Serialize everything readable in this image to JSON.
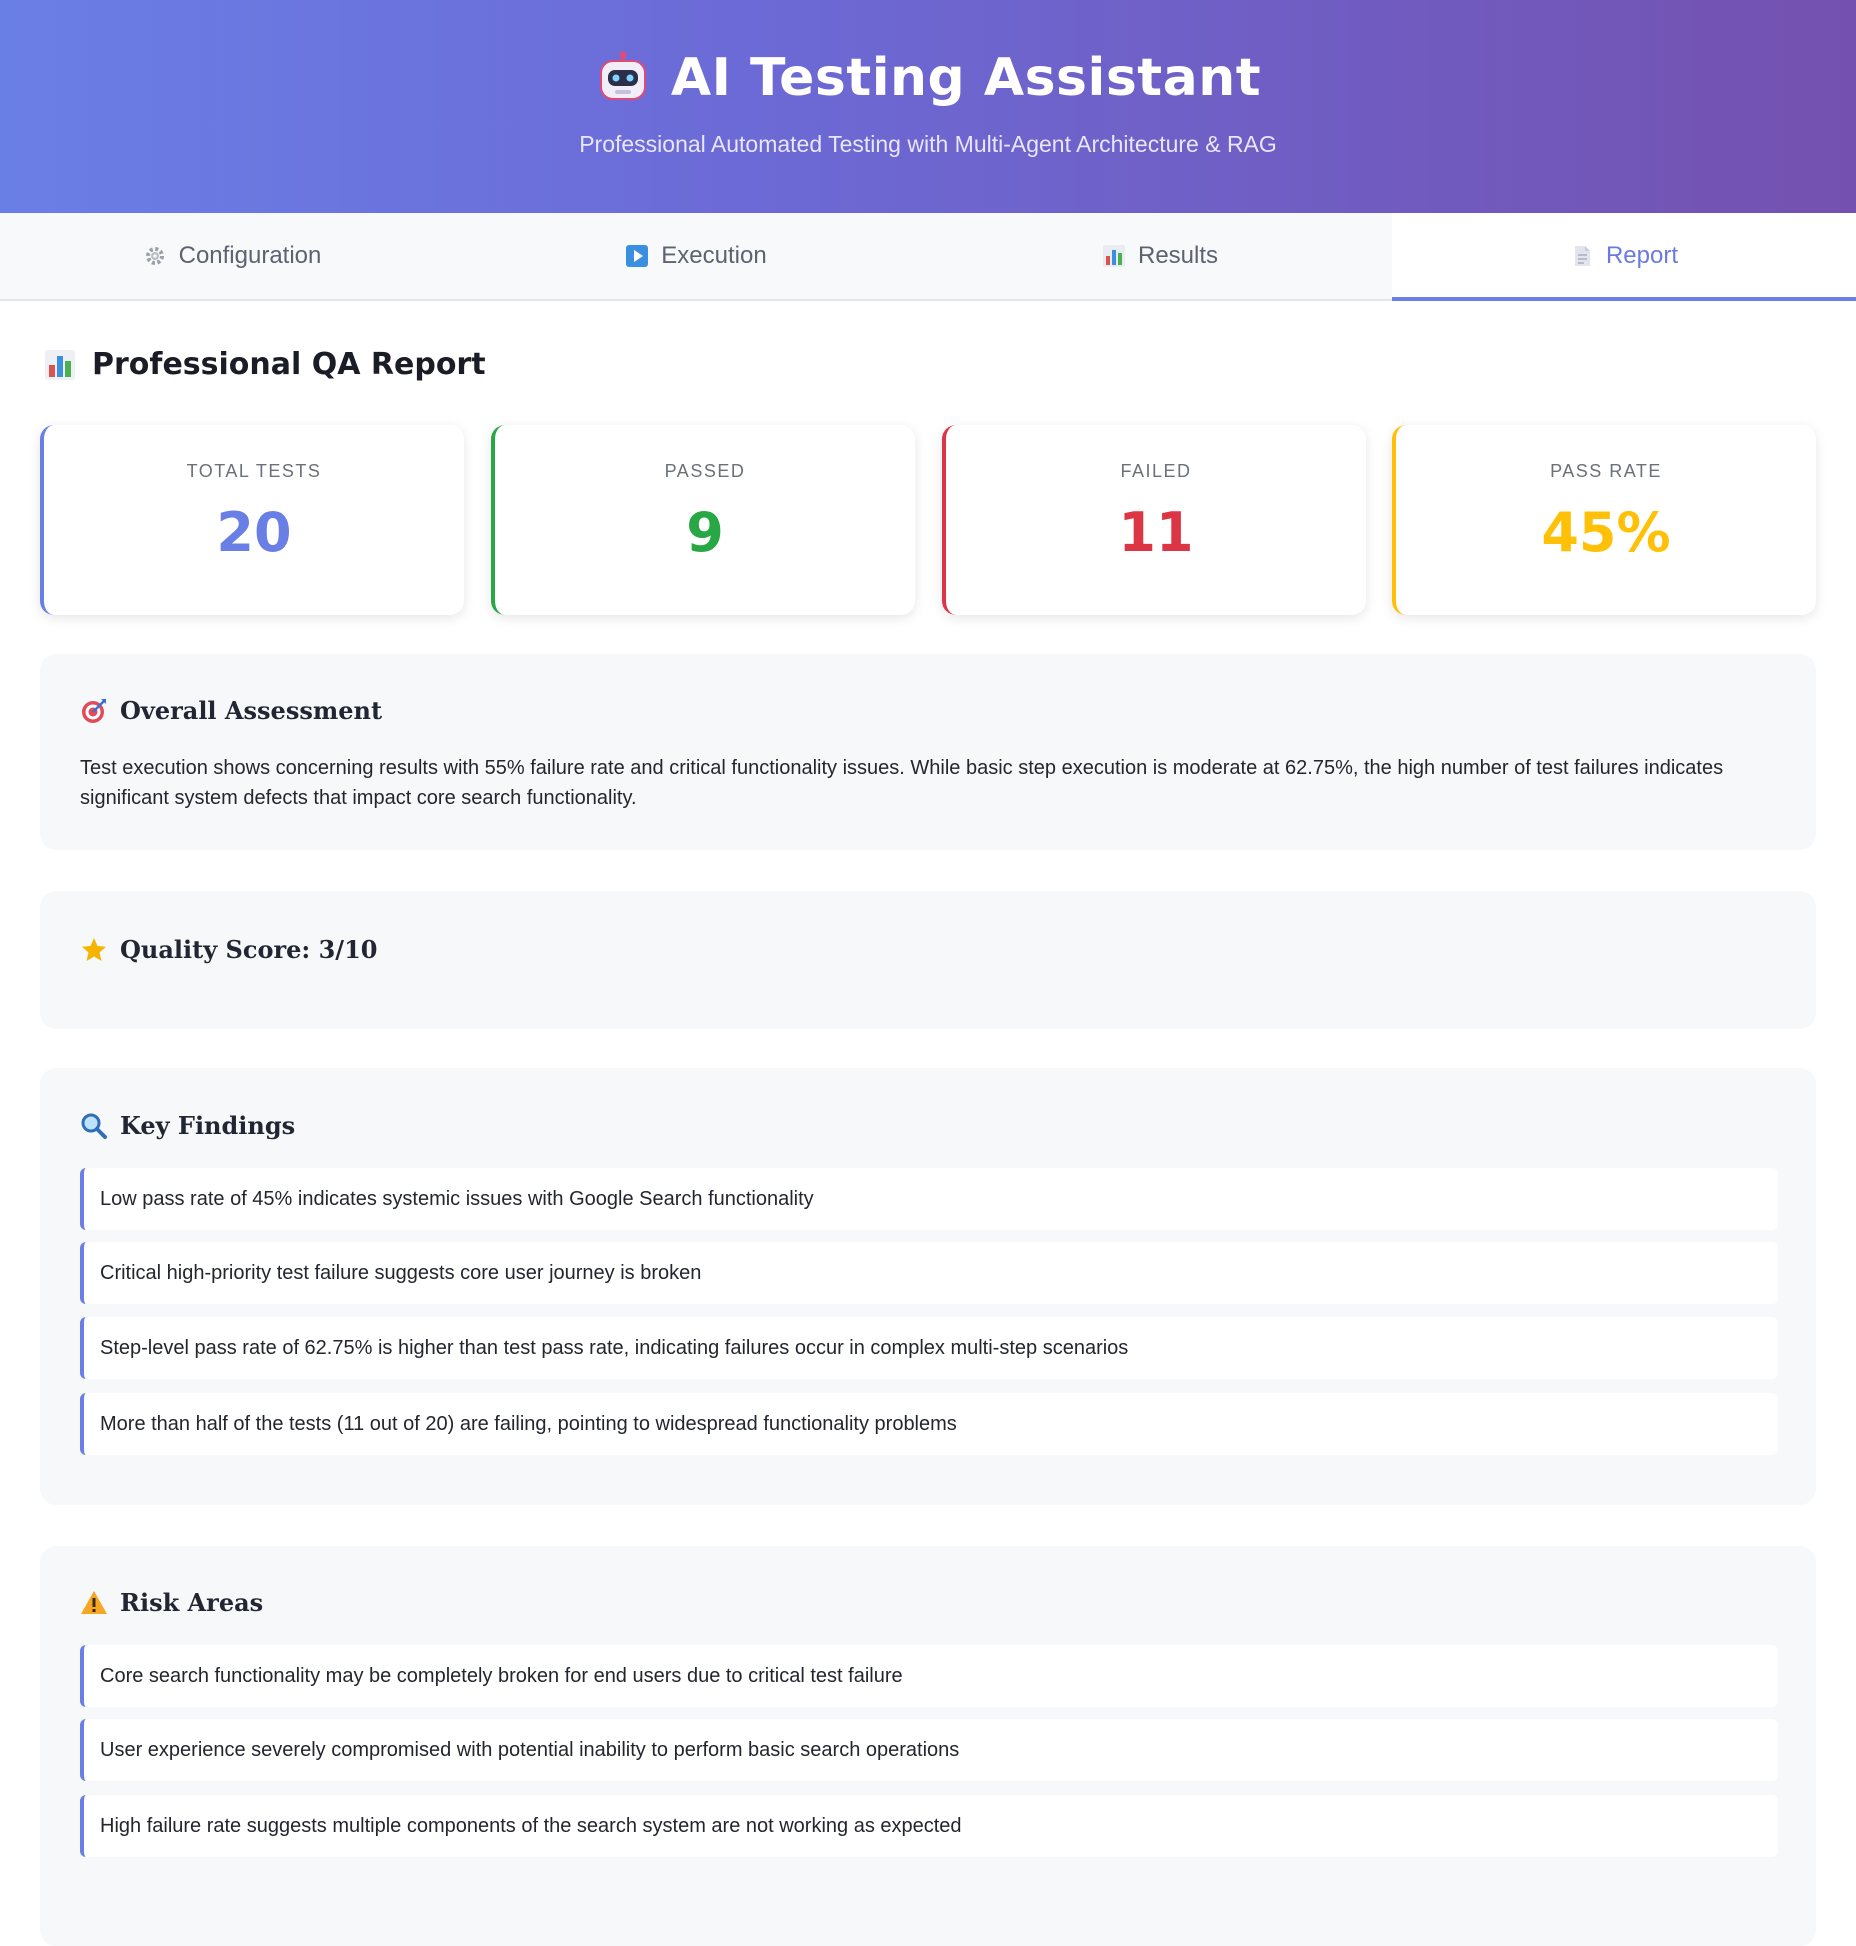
{
  "header": {
    "title": "AI Testing Assistant",
    "subtitle": "Professional Automated Testing with Multi-Agent Architecture & RAG",
    "icon": "robot-icon"
  },
  "tabs": [
    {
      "label": "Configuration",
      "icon": "gear-icon"
    },
    {
      "label": "Execution",
      "icon": "play-icon"
    },
    {
      "label": "Results",
      "icon": "bar-chart-icon"
    },
    {
      "label": "Report",
      "icon": "document-icon",
      "active": true
    }
  ],
  "report": {
    "title": "Professional QA Report",
    "stats": [
      {
        "label": "TOTAL TESTS",
        "value": "20",
        "color": "#6a7fe6"
      },
      {
        "label": "PASSED",
        "value": "9",
        "color": "#28a745"
      },
      {
        "label": "FAILED",
        "value": "11",
        "color": "#dc3545"
      },
      {
        "label": "PASS RATE",
        "value": "45%",
        "color": "#ffc107"
      }
    ],
    "assessment": {
      "title": "Overall Assessment",
      "text": "Test execution shows concerning results with 55% failure rate and critical functionality issues. While basic step execution is moderate at 62.75%, the high number of test failures indicates significant system defects that impact core search functionality."
    },
    "quality": {
      "title": "Quality Score: 3/10"
    },
    "findings": {
      "title": "Key Findings",
      "items": [
        "Low pass rate of 45% indicates systemic issues with Google Search functionality",
        "Critical high-priority test failure suggests core user journey is broken",
        "Step-level pass rate of 62.75% is higher than test pass rate, indicating failures occur in complex multi-step scenarios",
        "More than half of the tests (11 out of 20) are failing, pointing to widespread functionality problems"
      ]
    },
    "risks": {
      "title": "Risk Areas",
      "items": [
        "Core search functionality may be completely broken for end users due to critical test failure",
        "User experience severely compromised with potential inability to perform basic search operations",
        "High failure rate suggests multiple components of the search system are not working as expected"
      ]
    }
  }
}
